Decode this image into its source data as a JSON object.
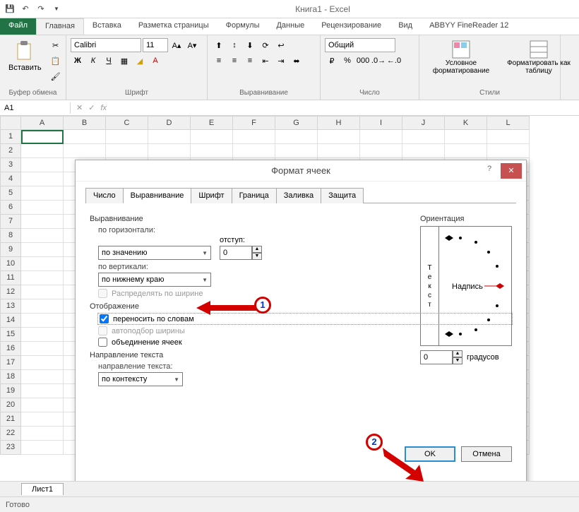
{
  "app": {
    "title": "Книга1 - Excel"
  },
  "qat": {
    "save": "save",
    "undo": "undo",
    "redo": "redo"
  },
  "tabs": {
    "file": "Файл",
    "home": "Главная",
    "insert": "Вставка",
    "layout": "Разметка страницы",
    "formulas": "Формулы",
    "data": "Данные",
    "review": "Рецензирование",
    "view": "Вид",
    "abbyy": "ABBYY FineReader 12"
  },
  "ribbon": {
    "paste": "Вставить",
    "clipboard": "Буфер обмена",
    "font_name": "Calibri",
    "font_size": "11",
    "font_group": "Шрифт",
    "align_group": "Выравнивание",
    "number_format": "Общий",
    "number_group": "Число",
    "cond_fmt": "Условное форматирование",
    "fmt_table": "Форматировать как таблицу",
    "styles_group": "Стили",
    "bold": "Ж",
    "italic": "К",
    "underline": "Ч"
  },
  "namebox": "A1",
  "cols": [
    "A",
    "B",
    "C",
    "D",
    "E",
    "F",
    "G",
    "H",
    "I",
    "J",
    "K",
    "L"
  ],
  "rows": [
    "1",
    "2",
    "3",
    "4",
    "5",
    "6",
    "7",
    "8",
    "9",
    "10",
    "11",
    "12",
    "13",
    "14",
    "15",
    "16",
    "17",
    "18",
    "19",
    "20",
    "21",
    "22",
    "23"
  ],
  "dialog": {
    "title": "Формат ячеек",
    "tabs": {
      "number": "Число",
      "align": "Выравнивание",
      "font": "Шрифт",
      "border": "Граница",
      "fill": "Заливка",
      "protect": "Защита"
    },
    "align_section": "Выравнивание",
    "h_label": "по горизонтали:",
    "h_value": "по значению",
    "indent_label": "отступ:",
    "indent_value": "0",
    "v_label": "по вертикали:",
    "v_value": "по нижнему краю",
    "distribute": "Распределять по ширине",
    "display_section": "Отображение",
    "wrap": "переносить по словам",
    "shrink": "автоподбор ширины",
    "merge": "объединение ячеек",
    "textdir_section": "Направление текста",
    "textdir_label": "направление текста:",
    "textdir_value": "по контексту",
    "orient_section": "Ориентация",
    "orient_vtext": [
      "Т",
      "е",
      "к",
      "с",
      "т"
    ],
    "orient_label": "Надпись",
    "degrees_value": "0",
    "degrees_label": "градусов",
    "ok": "OK",
    "cancel": "Отмена"
  },
  "callouts": {
    "n1": "1",
    "n2": "2"
  },
  "sheet_tab": "Лист1",
  "status": "Готово"
}
